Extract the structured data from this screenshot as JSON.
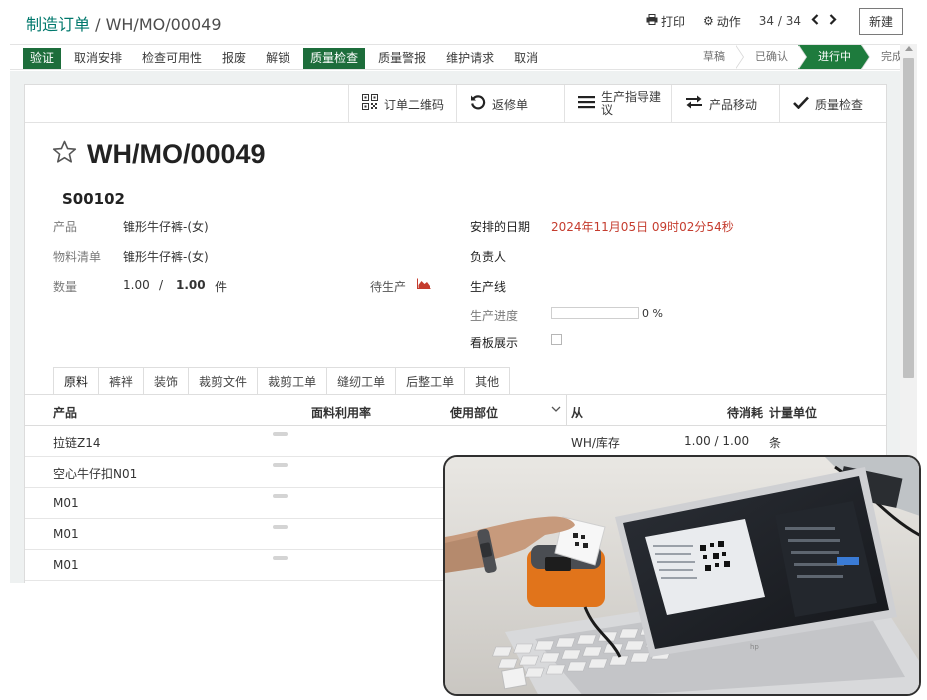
{
  "header": {
    "breadcrumb_root": "制造订单",
    "breadcrumb_sep": " / ",
    "breadcrumb_current": "WH/MO/00049",
    "print_label": "打印",
    "action_label": "动作",
    "pager_value": "34 / 34",
    "new_button": "新建"
  },
  "statusbar": {
    "buttons": [
      "验证",
      "取消安排",
      "检查可用性",
      "报废",
      "解锁",
      "质量检查",
      "质量警报",
      "维护请求",
      "取消"
    ],
    "stages": [
      "草稿",
      "已确认",
      "进行中",
      "完成"
    ],
    "active_stage": "进行中"
  },
  "sheet_toolbar": {
    "qr_label": "订单二维码",
    "rework_label": "返修单",
    "guide_label_line1": "生产指导建",
    "guide_label_line2": "议",
    "move_label": "产品移动",
    "quality_label": "质量检查"
  },
  "record": {
    "title": "WH/MO/00049",
    "origin": "S00102",
    "product_label": "产品",
    "product_value": "锥形牛仔裤-(女)",
    "bom_label": "物料清单",
    "bom_value": "锥形牛仔裤-(女)",
    "qty_label": "数量",
    "qty_value": "1.00",
    "qty_sep": "/",
    "qty_planned": "1.00",
    "qty_uom": "件",
    "pending_label": "待生产",
    "date_label": "安排的日期",
    "date_value": "2024年11月05日 09时02分54秒",
    "owner_label": "负责人",
    "line_label": "生产线",
    "progress_label": "生产进度",
    "progress_percent": 0,
    "progress_text": "0 %",
    "kanban_label": "看板展示"
  },
  "tabs": [
    "原料",
    "裤袢",
    "装饰",
    "裁剪文件",
    "裁剪工单",
    "缝纫工单",
    "后整工单",
    "其他"
  ],
  "table": {
    "headers": {
      "product": "产品",
      "fabric_rate": "面料利用率",
      "usage_part": "使用部位",
      "from": "从",
      "to_consume": "待消耗",
      "uom": "计量单位"
    },
    "rows": [
      {
        "product": "拉链Z14",
        "from": "WH/库存",
        "qty": "1.00 /  1.00",
        "uom": "条"
      },
      {
        "product": "空心牛仔扣N01",
        "from": "",
        "qty": "",
        "uom": ""
      },
      {
        "product": "M01",
        "from": "",
        "qty": "",
        "uom": ""
      },
      {
        "product": "M01",
        "from": "",
        "qty": "",
        "uom": ""
      },
      {
        "product": "M01",
        "from": "",
        "qty": "",
        "uom": ""
      }
    ]
  },
  "colors": {
    "primary_green": "#1d6d3b",
    "breadcrumb_link": "#00786c",
    "date_red": "#c53c2e"
  }
}
